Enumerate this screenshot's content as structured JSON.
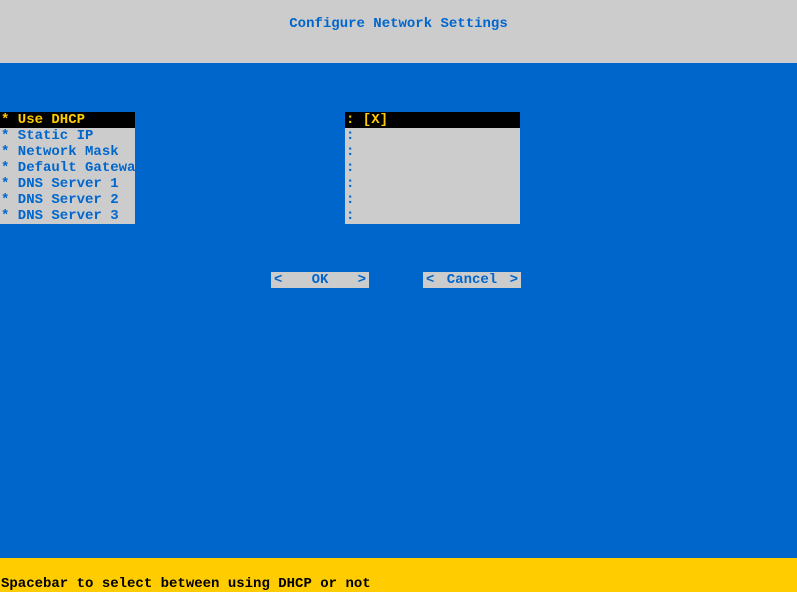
{
  "header": {
    "title": "Configure Network Settings"
  },
  "menu": {
    "items": [
      {
        "label": "* Use DHCP",
        "selected": true
      },
      {
        "label": "* Static IP",
        "selected": false
      },
      {
        "label": "* Network Mask",
        "selected": false
      },
      {
        "label": "* Default Gateway",
        "selected": false
      },
      {
        "label": "* DNS Server 1",
        "selected": false
      },
      {
        "label": "* DNS Server 2",
        "selected": false
      },
      {
        "label": "* DNS Server 3",
        "selected": false
      }
    ]
  },
  "values": {
    "items": [
      {
        "label": ": [X]",
        "selected": true
      },
      {
        "label": ":",
        "selected": false
      },
      {
        "label": ":",
        "selected": false
      },
      {
        "label": ":",
        "selected": false
      },
      {
        "label": ":",
        "selected": false
      },
      {
        "label": ":",
        "selected": false
      },
      {
        "label": ":",
        "selected": false
      }
    ]
  },
  "buttons": {
    "ok": {
      "left": "<",
      "label": "OK",
      "right": ">"
    },
    "cancel": {
      "left": "<",
      "label": "Cancel",
      "right": ">"
    }
  },
  "footer": {
    "hint": "Spacebar to select between using DHCP or not"
  }
}
